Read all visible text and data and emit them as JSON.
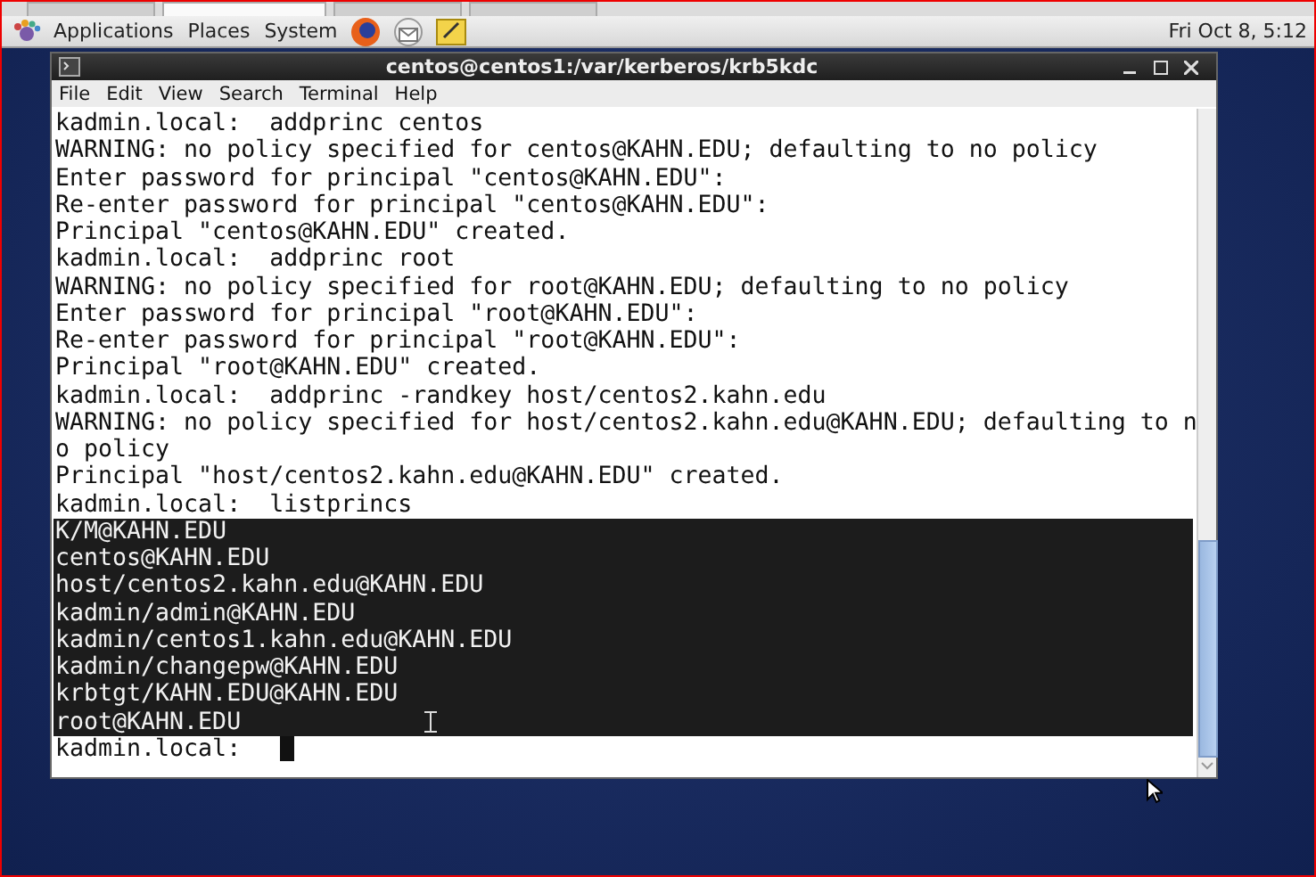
{
  "host_tabs": [
    {
      "selected": false
    },
    {
      "selected": true
    },
    {
      "selected": false
    },
    {
      "selected": false
    }
  ],
  "panel": {
    "menus": [
      "Applications",
      "Places",
      "System"
    ],
    "clock": "Fri Oct  8, 5:12"
  },
  "window": {
    "title": "centos@centos1:/var/kerberos/krb5kdc"
  },
  "menu_bar": [
    "File",
    "Edit",
    "View",
    "Search",
    "Terminal",
    "Help"
  ],
  "terminal": {
    "lines": [
      {
        "text": "kadmin.local:  addprinc centos",
        "selected": false
      },
      {
        "text": "WARNING: no policy specified for centos@KAHN.EDU; defaulting to no policy",
        "selected": false
      },
      {
        "text": "Enter password for principal \"centos@KAHN.EDU\":",
        "selected": false
      },
      {
        "text": "Re-enter password for principal \"centos@KAHN.EDU\":",
        "selected": false
      },
      {
        "text": "Principal \"centos@KAHN.EDU\" created.",
        "selected": false
      },
      {
        "text": "kadmin.local:  addprinc root",
        "selected": false
      },
      {
        "text": "WARNING: no policy specified for root@KAHN.EDU; defaulting to no policy",
        "selected": false
      },
      {
        "text": "Enter password for principal \"root@KAHN.EDU\":",
        "selected": false
      },
      {
        "text": "Re-enter password for principal \"root@KAHN.EDU\":",
        "selected": false
      },
      {
        "text": "Principal \"root@KAHN.EDU\" created.",
        "selected": false
      },
      {
        "text": "kadmin.local:  addprinc -randkey host/centos2.kahn.edu",
        "selected": false
      },
      {
        "text": "WARNING: no policy specified for host/centos2.kahn.edu@KAHN.EDU; defaulting to n",
        "selected": false
      },
      {
        "text": "o policy",
        "selected": false
      },
      {
        "text": "Principal \"host/centos2.kahn.edu@KAHN.EDU\" created.",
        "selected": false
      },
      {
        "text": "kadmin.local:  listprincs",
        "selected": false
      },
      {
        "text": "K/M@KAHN.EDU",
        "selected": true
      },
      {
        "text": "centos@KAHN.EDU",
        "selected": true
      },
      {
        "text": "host/centos2.kahn.edu@KAHN.EDU",
        "selected": true
      },
      {
        "text": "kadmin/admin@KAHN.EDU",
        "selected": true
      },
      {
        "text": "kadmin/centos1.kahn.edu@KAHN.EDU",
        "selected": true
      },
      {
        "text": "kadmin/changepw@KAHN.EDU",
        "selected": true
      },
      {
        "text": "krbtgt/KAHN.EDU@KAHN.EDU",
        "selected": true
      },
      {
        "text": "root@KAHN.EDU",
        "selected": true
      },
      {
        "text": "kadmin.local:  ",
        "selected": false
      }
    ]
  }
}
